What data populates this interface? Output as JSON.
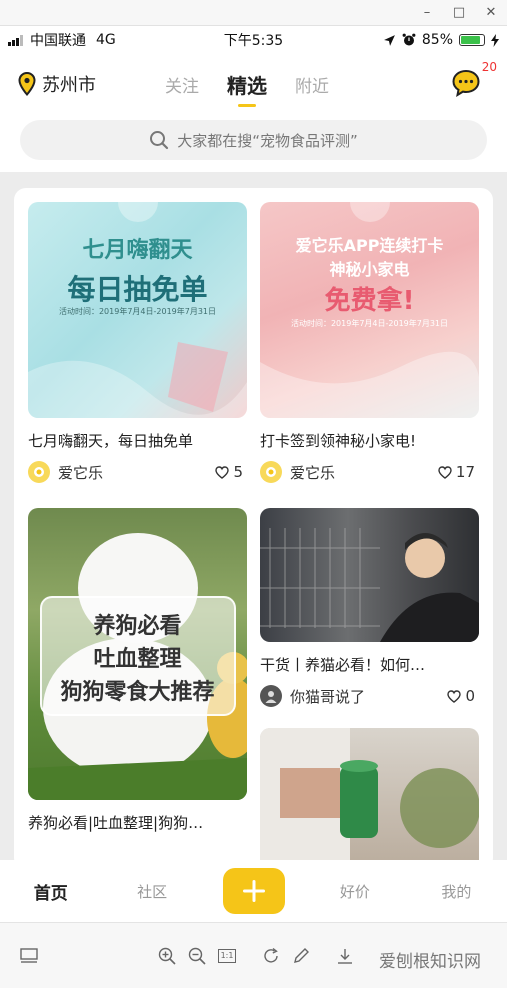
{
  "window": {
    "minimize": "–",
    "maximize": "□",
    "close": "✕"
  },
  "status_bar": {
    "carrier": "中国联通",
    "network": "4G",
    "time": "下午5:35",
    "battery_pct": "85%",
    "battery_level": 0.85
  },
  "header": {
    "city": "苏州市",
    "tabs": [
      {
        "label": "关注"
      },
      {
        "label": "精选"
      },
      {
        "label": "附近"
      }
    ],
    "message_badge": "20"
  },
  "search": {
    "placeholder": "大家都在搜“宠物食品评测”"
  },
  "feed": {
    "cards": [
      {
        "title": "七月嗨翻天，每日抽免单",
        "author": "爱它乐",
        "likes": "5",
        "image_text": {
          "line1": "七月嗨翻天",
          "line2": "每日抽免单",
          "small": "活动时间：2019年7月4日-2019年7月31日"
        }
      },
      {
        "title": "打卡签到领神秘小家电!",
        "author": "爱它乐",
        "likes": "17",
        "image_text": {
          "line1": "爱它乐APP连续打卡",
          "line2": "神秘小家电",
          "line3": "免费拿!",
          "small": "活动时间：2019年7月4日-2019年7月31日"
        }
      },
      {
        "title": "养狗必看|吐血整理|狗狗…",
        "image_text": {
          "line1": "养狗必看",
          "line2": "吐血整理",
          "line3": "狗狗零食大推荐"
        }
      },
      {
        "title": "干货丨养猫必看！如何…",
        "author": "你猫哥说了",
        "likes": "0"
      },
      {
        "title": ""
      }
    ]
  },
  "tabbar": {
    "home": "首页",
    "community": "社区",
    "deals": "好价",
    "mine": "我的"
  },
  "viewer_toolbar": {
    "page_fit": "1:1"
  },
  "watermark": "爱刨根知识网",
  "colors": {
    "accent": "#f5c518",
    "badge": "#e33333"
  }
}
